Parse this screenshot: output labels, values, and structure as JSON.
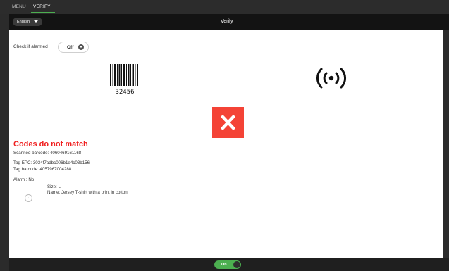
{
  "nav": {
    "tabs": [
      {
        "label": "MENU",
        "active": false
      },
      {
        "label": "VERIFY",
        "active": true
      }
    ]
  },
  "header": {
    "language": "English",
    "title": "Verify"
  },
  "alarm_check": {
    "label": "Check if alarmed",
    "toggle_value": "Off"
  },
  "barcode": {
    "digits": "32456"
  },
  "result": {
    "status": "Codes do not match",
    "scanned_barcode": "Scanned barcode: 4060469161168",
    "tag_epc": "Tag EPC: 3034f7adbc006b1e4c03b156",
    "tag_barcode": "Tag barcode: 4057967004288",
    "alarm": "Alarm : No"
  },
  "product": {
    "size": "Size: L",
    "name": "Name: Jersey T-shirt with a print in cotton"
  },
  "footer": {
    "toggle_label": "On"
  },
  "colors": {
    "error": "#f44336",
    "accent": "#4caf50",
    "mismatch_text": "#f02020"
  }
}
